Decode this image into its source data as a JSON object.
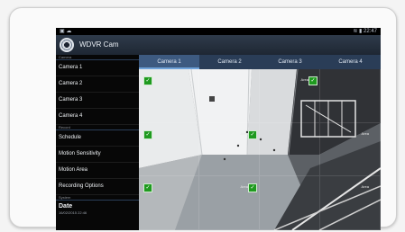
{
  "status_bar": {
    "left_icons": "▣ ☁",
    "right_text": "≋ ▮ 22:47"
  },
  "app": {
    "title": "WDVR Cam",
    "logo_icon": "camera-lens-icon"
  },
  "sidebar": {
    "sections": [
      {
        "label": "Camera",
        "items": [
          "Camera 1",
          "Camera 2",
          "Camera 3",
          "Camera 4"
        ]
      },
      {
        "label": "Record",
        "items": [
          "Schedule",
          "Motion Sensitivity",
          "Motion Area",
          "Recording Options"
        ]
      },
      {
        "label": "System",
        "items": []
      }
    ],
    "date": {
      "title": "Date",
      "value": "16/02/2015 22:46"
    }
  },
  "tabs": {
    "items": [
      "Camera 1",
      "Camera 2",
      "Camera 3",
      "Camera 4"
    ],
    "active_index": 0
  },
  "motion_grid": {
    "rows": 3,
    "cols": 4,
    "area_label": "Area"
  },
  "colors": {
    "accent": "#3d5a80",
    "tab_bar": "#2a3d57",
    "check": "#1f9a1f"
  }
}
